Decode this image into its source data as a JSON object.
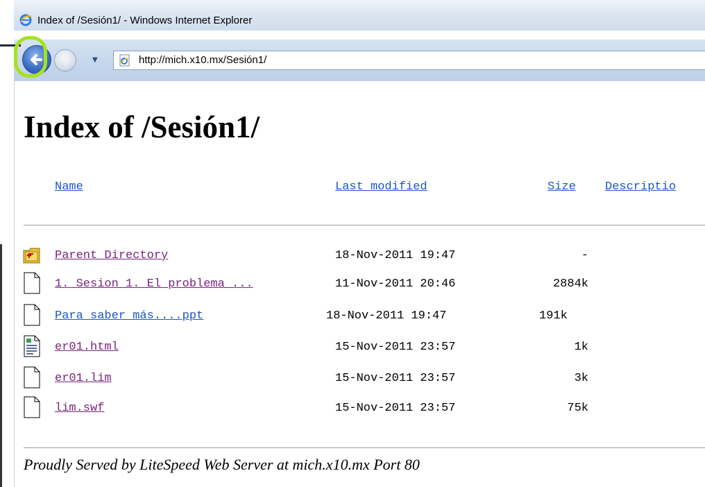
{
  "window": {
    "title": "Index of /Sesión1/ - Windows Internet Explorer",
    "url": "http://mich.x10.mx/Sesión1/"
  },
  "page": {
    "heading": "Index of /Sesión1/",
    "columns": {
      "name": "Name",
      "last_modified": "Last modified",
      "size": "Size",
      "description": "Descriptio"
    },
    "rows": [
      {
        "icon": "parent-folder-icon",
        "name": "Parent Directory",
        "date": "18-Nov-2011 19:47",
        "size": "-"
      },
      {
        "icon": "file-icon",
        "name": "1. Sesion 1. El problema ...",
        "date": "11-Nov-2011 20:46",
        "size": "2884k"
      },
      {
        "icon": "file-icon",
        "name": "Para saber más....ppt",
        "date": "18-Nov-2011 19:47",
        "size": "191k"
      },
      {
        "icon": "html-file-icon",
        "name": "er01.html",
        "date": "15-Nov-2011 23:57",
        "size": "1k"
      },
      {
        "icon": "file-icon",
        "name": "er01.lim",
        "date": "15-Nov-2011 23:57",
        "size": "3k"
      },
      {
        "icon": "file-icon",
        "name": "lim.swf",
        "date": "15-Nov-2011 23:57",
        "size": "75k"
      }
    ],
    "footer": "Proudly Served by LiteSpeed Web Server at mich.x10.mx Port 80"
  },
  "colors": {
    "link_visited": "#7a237b",
    "link_unvisited": "#1a56c9",
    "highlight": "#a6e21e"
  }
}
